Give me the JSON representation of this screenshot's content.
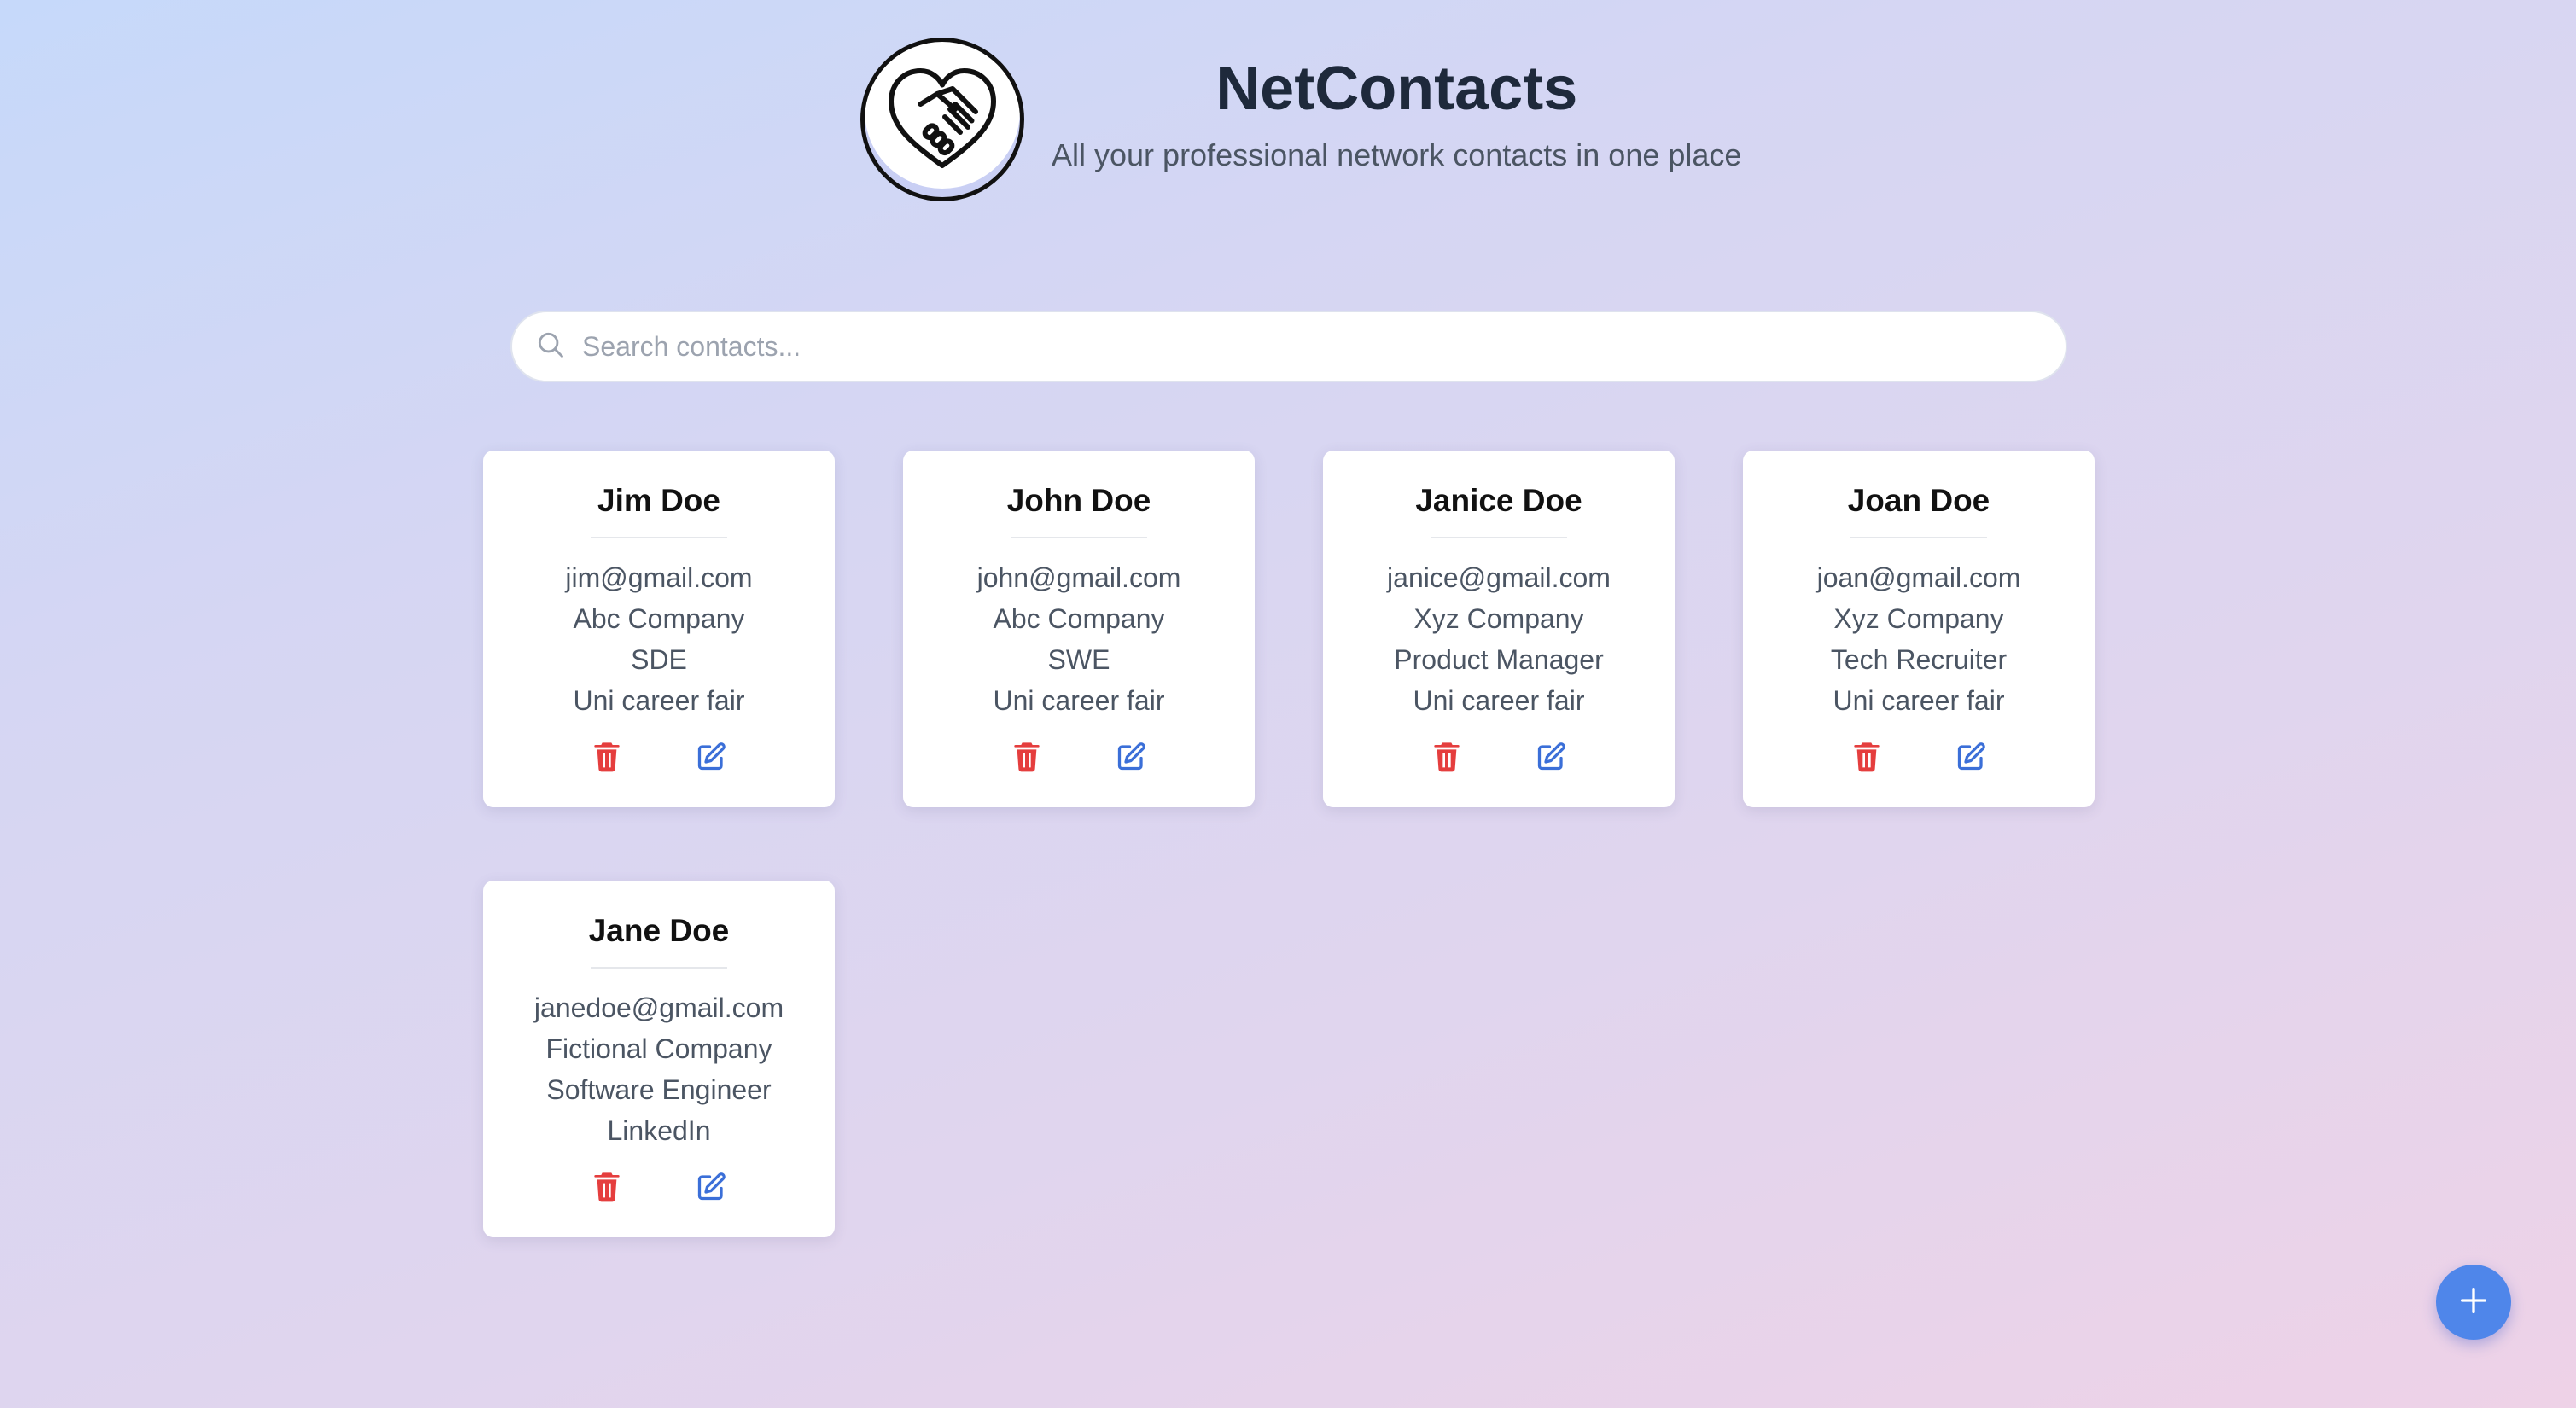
{
  "header": {
    "title": "NetContacts",
    "subtitle": "All your professional network contacts in one place",
    "logo_icon": "handshake-heart-icon"
  },
  "search": {
    "placeholder": "Search contacts...",
    "value": "",
    "icon": "search-icon"
  },
  "contacts": [
    {
      "name": "Jim Doe",
      "email": "jim@gmail.com",
      "company": "Abc Company",
      "role": "SDE",
      "source": "Uni career fair"
    },
    {
      "name": "John Doe",
      "email": "john@gmail.com",
      "company": "Abc Company",
      "role": "SWE",
      "source": "Uni career fair"
    },
    {
      "name": "Janice Doe",
      "email": "janice@gmail.com",
      "company": "Xyz Company",
      "role": "Product Manager",
      "source": "Uni career fair"
    },
    {
      "name": "Joan Doe",
      "email": "joan@gmail.com",
      "company": "Xyz Company",
      "role": "Tech Recruiter",
      "source": "Uni career fair"
    },
    {
      "name": "Jane Doe",
      "email": "janedoe@gmail.com",
      "company": "Fictional Company",
      "role": "Software Engineer",
      "source": "LinkedIn"
    }
  ],
  "actions": {
    "delete_icon": "trash-icon",
    "edit_icon": "edit-icon",
    "add_icon": "plus-icon"
  },
  "colors": {
    "accent": "#4f86ea",
    "delete": "#e53e3e",
    "edit": "#3b6fd8",
    "title": "#1e293b"
  }
}
